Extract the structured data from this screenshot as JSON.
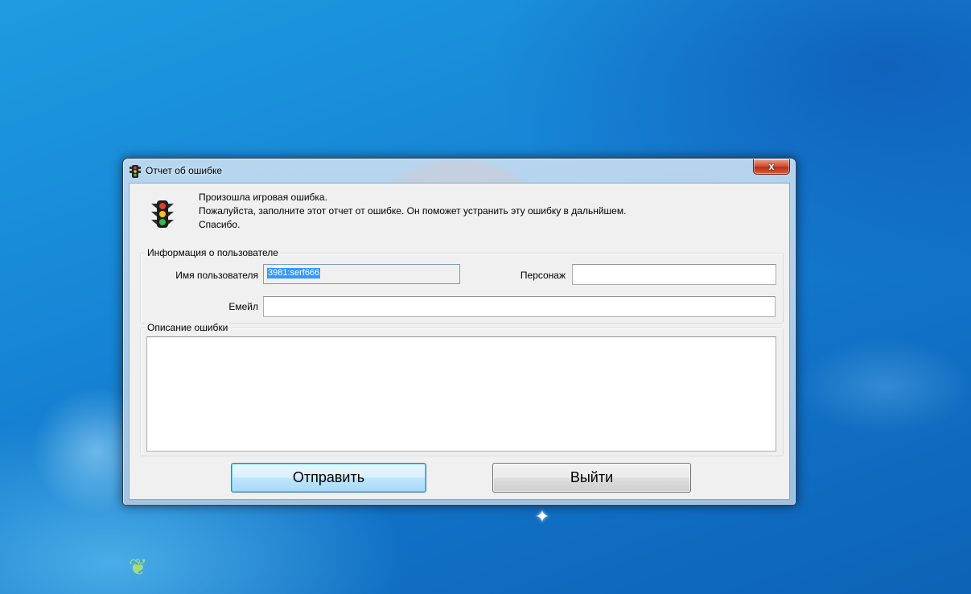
{
  "window": {
    "title": "Отчет об ошибке",
    "close_symbol": "x",
    "icon": "traffic-light-icon"
  },
  "message": {
    "line1": "Произошла игровая ошибка.",
    "line2": "Пожалуйста, заполните этот отчет от ошибке. Он поможет устранить эту ошибку в дальнйшем.",
    "line3": "Спасибо."
  },
  "user_info": {
    "group_label": "Информация о пользователе",
    "username_label": "Имя пользователя",
    "username_value": "3981:serf666",
    "character_label": "Персонаж",
    "character_value": "",
    "email_label": "Емейл",
    "email_value": ""
  },
  "description": {
    "group_label": "Описание ошибки",
    "value": ""
  },
  "buttons": {
    "send_label": "Отправить",
    "exit_label": "Выйти"
  },
  "colors": {
    "desktop_blue": "#1787d6",
    "selection": "#3399ff",
    "close_red": "#c9422a"
  }
}
